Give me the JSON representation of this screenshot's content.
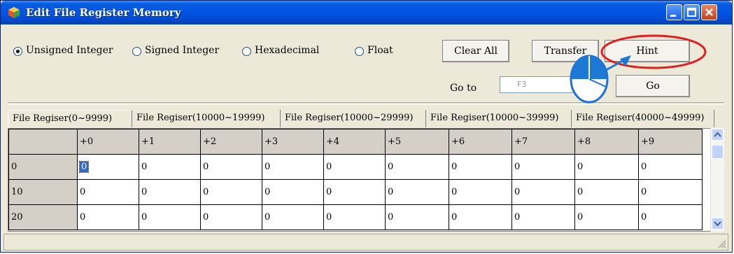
{
  "window": {
    "title": "Edit File Register Memory"
  },
  "format_options": [
    {
      "label": "Unsigned Integer",
      "selected": true
    },
    {
      "label": "Signed Integer",
      "selected": false
    },
    {
      "label": "Hexadecimal",
      "selected": false
    },
    {
      "label": "Float",
      "selected": false
    }
  ],
  "buttons": {
    "clear_all": "Clear All",
    "transfer": "Transfer",
    "hint": "Hint",
    "go": "Go"
  },
  "goto": {
    "label": "Go to",
    "value": "F3"
  },
  "tabs": [
    "File Regiser(0~9999)",
    "File Regiser(10000~19999)",
    "File Regiser(10000~29999)",
    "File Regiser(10000~39999)",
    "File Regiser(40000~49999)"
  ],
  "grid": {
    "columns": [
      "+0",
      "+1",
      "+2",
      "+3",
      "+4",
      "+5",
      "+6",
      "+7",
      "+8",
      "+9"
    ],
    "rows": [
      {
        "label": "0",
        "values": [
          "0",
          "0",
          "0",
          "0",
          "0",
          "0",
          "0",
          "0",
          "0",
          "0"
        ]
      },
      {
        "label": "10",
        "values": [
          "0",
          "0",
          "0",
          "0",
          "0",
          "0",
          "0",
          "0",
          "0",
          "0"
        ]
      },
      {
        "label": "20",
        "values": [
          "0",
          "0",
          "0",
          "0",
          "0",
          "0",
          "0",
          "0",
          "0",
          "0"
        ]
      }
    ]
  },
  "colors": {
    "title_bar": "#0054e3",
    "highlight_ellipse": "#e02020",
    "annotation_arrow": "#1e78d6"
  }
}
